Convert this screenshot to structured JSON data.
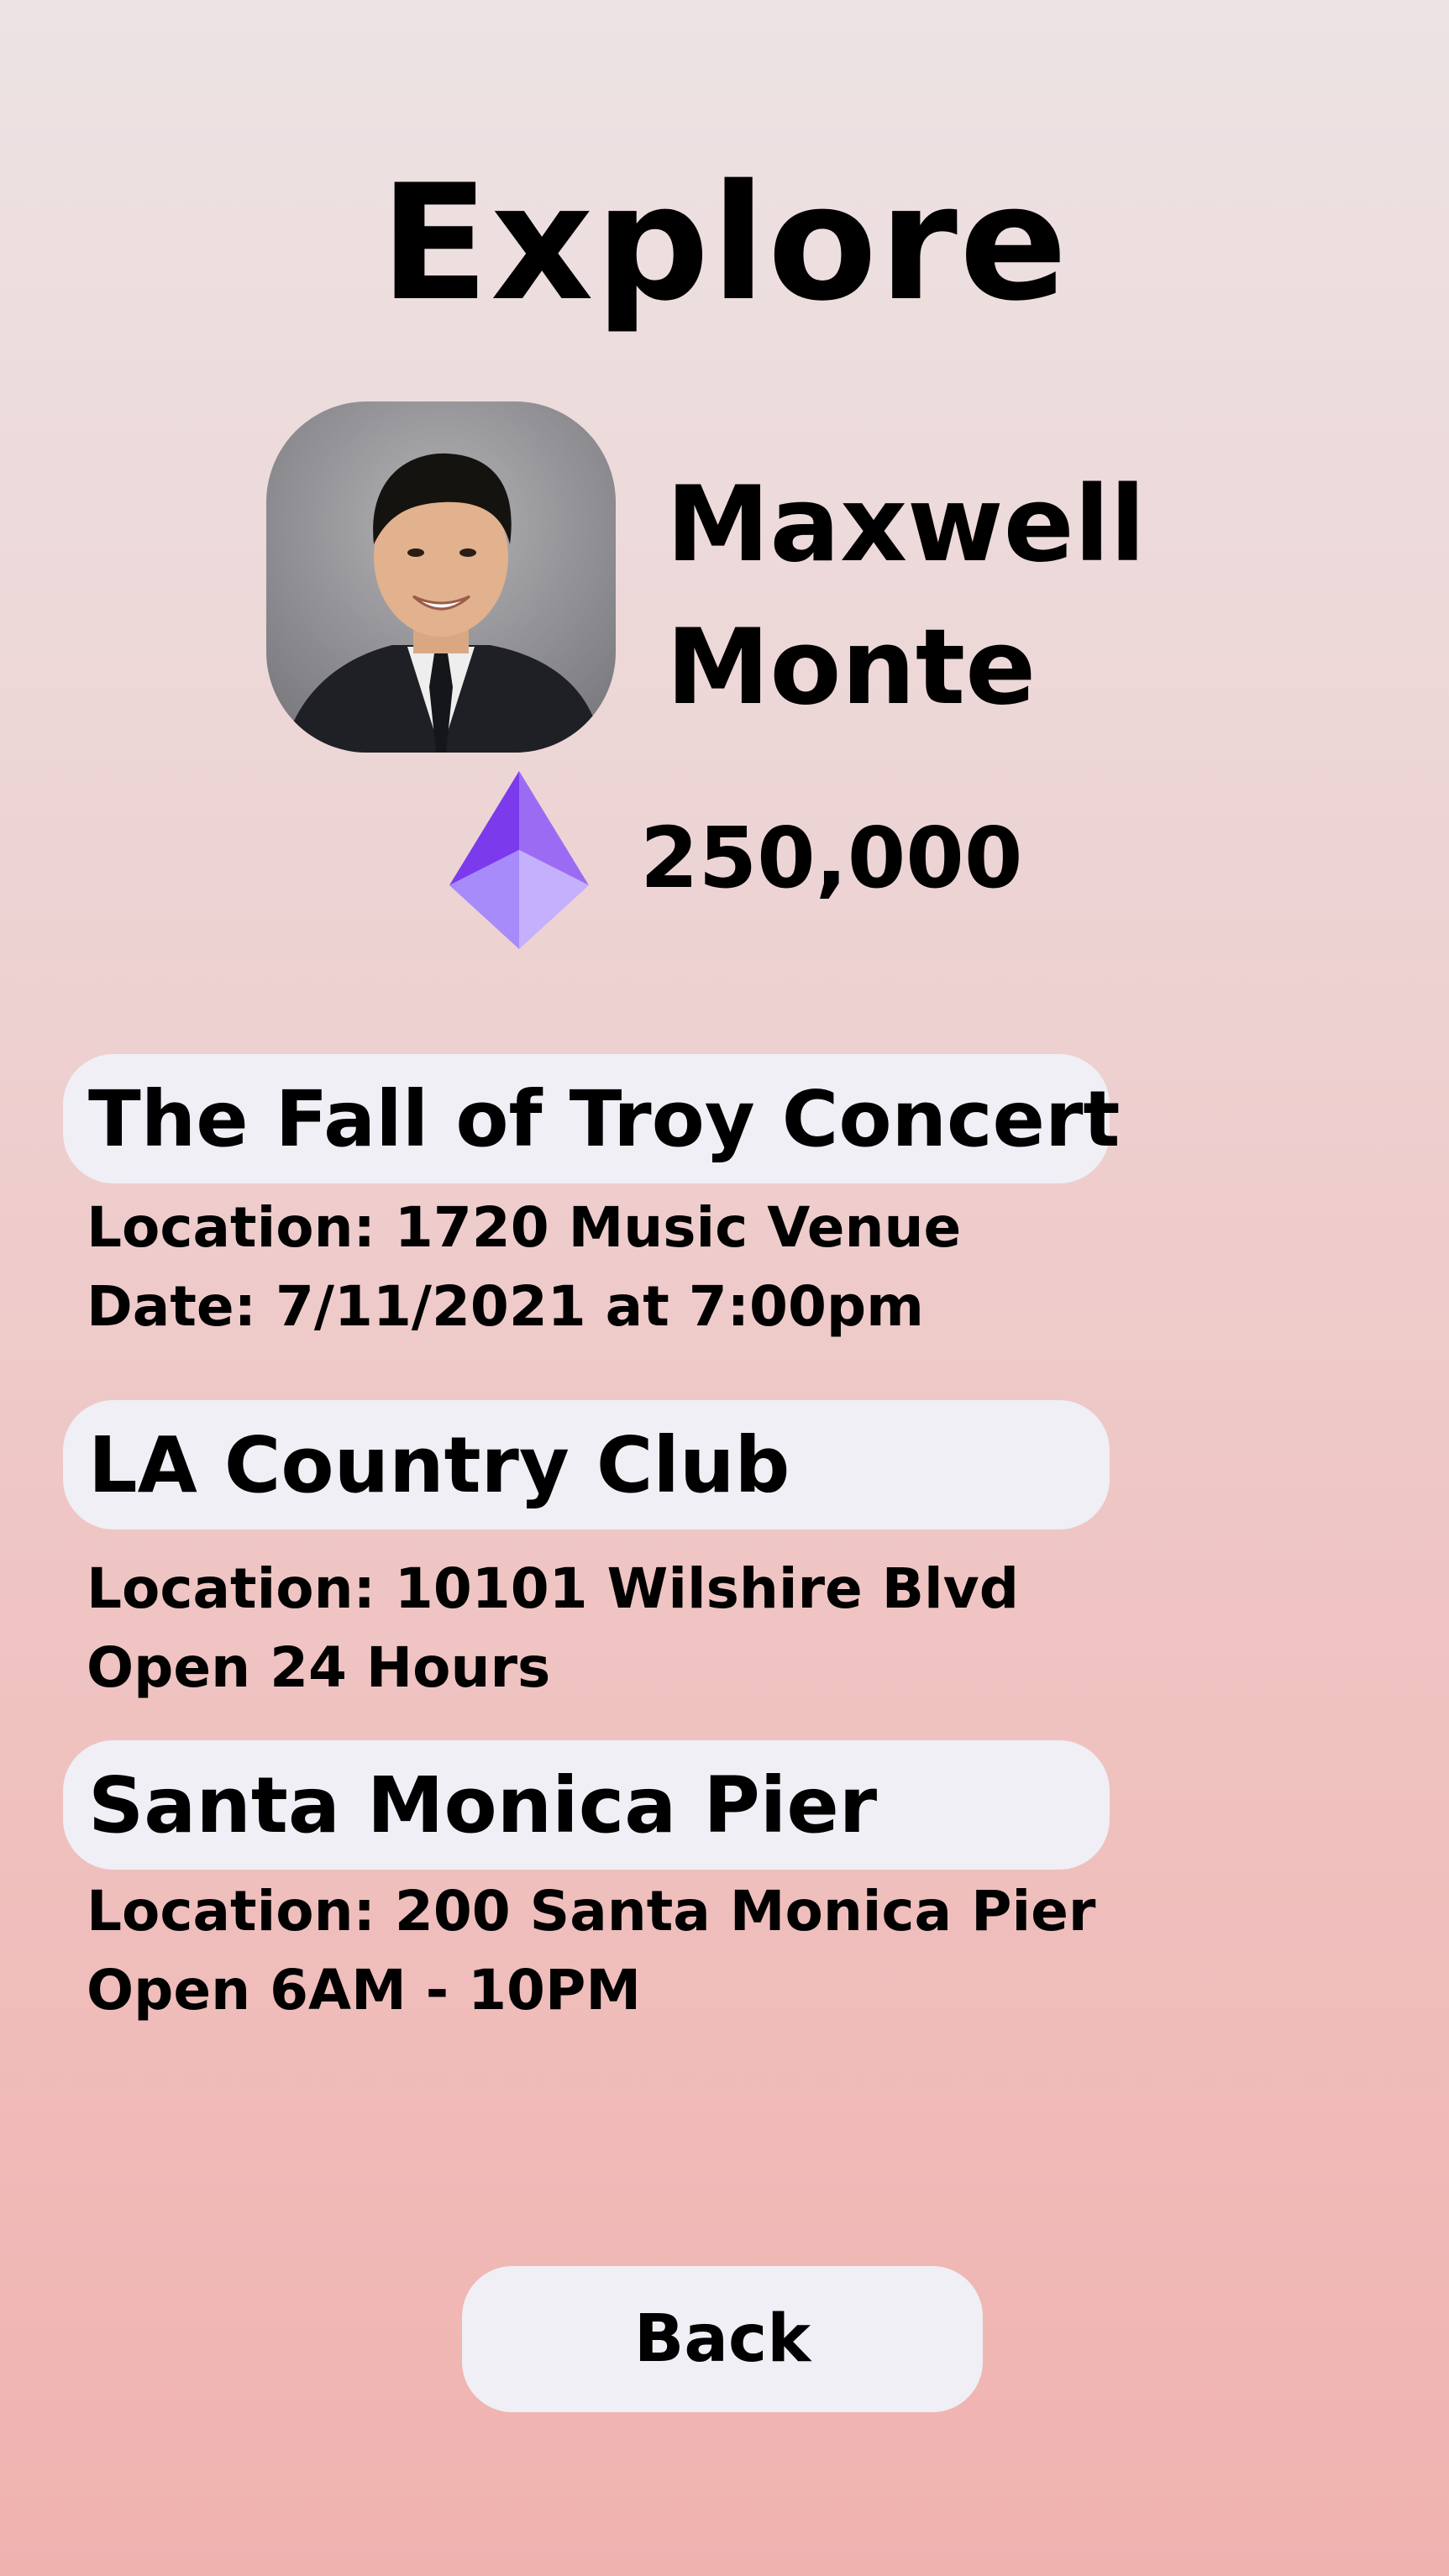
{
  "header": {
    "title": "Explore"
  },
  "profile": {
    "name_line1": "Maxwell",
    "name_line2": "Monte",
    "avatar_icon": "profile-photo",
    "balance": "250,000",
    "currency_icon": "ethereum-diamond-icon",
    "currency_color": "#8b5cf6"
  },
  "places": [
    {
      "title": "The Fall of Troy Concert",
      "line1": "Location: 1720 Music Venue",
      "line2": "Date: 7/11/2021 at 7:00pm"
    },
    {
      "title": "LA Country Club",
      "line1": "Location: 10101 Wilshire Blvd",
      "line2": "Open 24 Hours"
    },
    {
      "title": "Santa Monica Pier",
      "line1": "Location: 200 Santa Monica Pier",
      "line2": "Open 6AM - 10PM"
    }
  ],
  "footer": {
    "back_label": "Back"
  },
  "colors": {
    "background_top": "#ede3e4",
    "background_bottom": "#f0b2af",
    "pill_background": "#efeff5"
  }
}
